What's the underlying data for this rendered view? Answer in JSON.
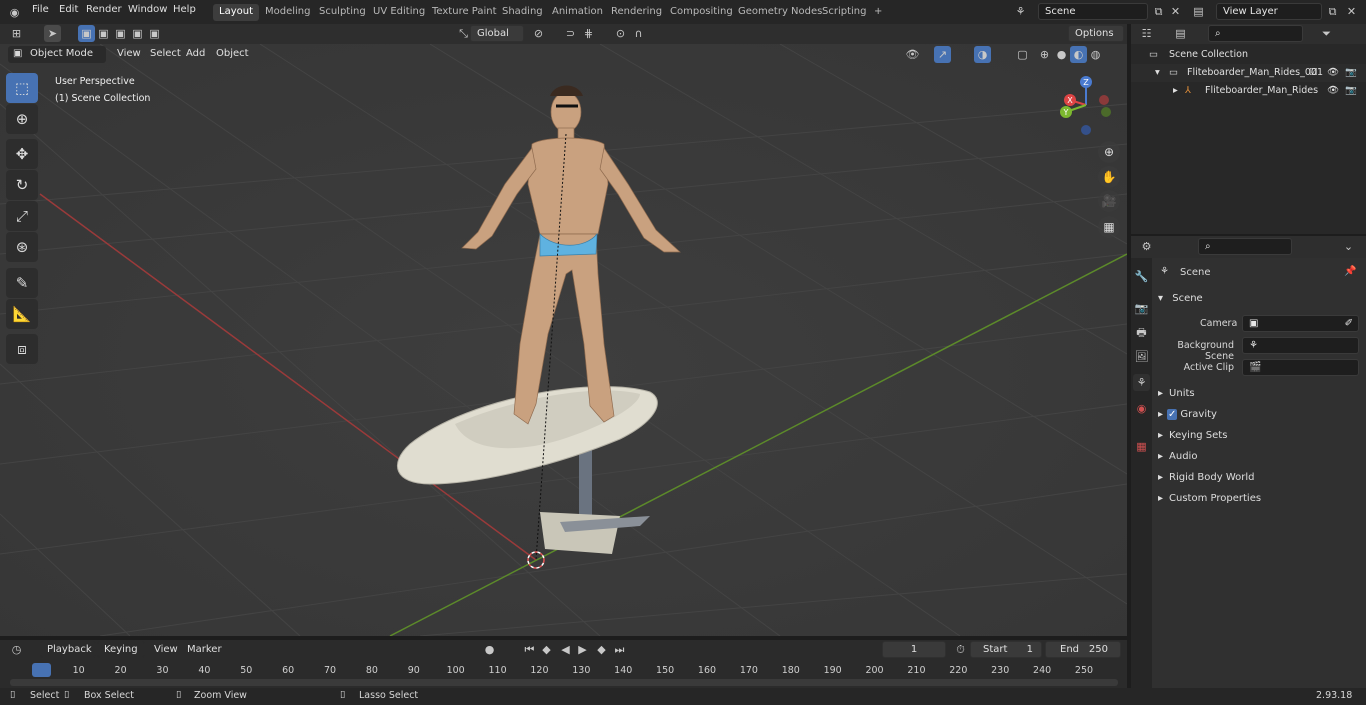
{
  "menus": [
    "File",
    "Edit",
    "Render",
    "Window",
    "Help"
  ],
  "workspaces": [
    "Layout",
    "Modeling",
    "Sculpting",
    "UV Editing",
    "Texture Paint",
    "Shading",
    "Animation",
    "Rendering",
    "Compositing",
    "Geometry Nodes",
    "Scripting"
  ],
  "add_workspace": "+",
  "scene_name": "Scene",
  "view_layer": "View Layer",
  "header": {
    "transform_orientation": "Global",
    "options": "Options"
  },
  "viewport": {
    "mode": "Object Mode",
    "menus": [
      "View",
      "Select",
      "Add",
      "Object"
    ],
    "perspective_label": "User Perspective",
    "collection_label": "(1) Scene Collection",
    "gizmo": {
      "x": "X",
      "y": "Y",
      "z": "Z"
    }
  },
  "outliner": {
    "items": [
      {
        "label": "Scene Collection",
        "level": 0
      },
      {
        "label": "Fliteboarder_Man_Rides_001",
        "level": 1
      },
      {
        "label": "Fliteboarder_Man_Rides",
        "level": 2
      }
    ]
  },
  "properties": {
    "context": "Scene",
    "section": "Scene",
    "fields": [
      {
        "label": "Camera",
        "value": ""
      },
      {
        "label": "Background Scene",
        "value": ""
      },
      {
        "label": "Active Clip",
        "value": ""
      }
    ],
    "panels": [
      "Units",
      "Gravity",
      "Keying Sets",
      "Audio",
      "Rigid Body World",
      "Custom Properties"
    ]
  },
  "timeline": {
    "menus": [
      "Playback",
      "Keying",
      "View",
      "Marker"
    ],
    "current_frame": "1",
    "start_label": "Start",
    "start_value": "1",
    "end_label": "End",
    "end_value": "250",
    "ticks": [
      "1",
      "10",
      "20",
      "30",
      "40",
      "50",
      "60",
      "70",
      "80",
      "90",
      "100",
      "110",
      "120",
      "130",
      "140",
      "150",
      "160",
      "170",
      "180",
      "190",
      "200",
      "210",
      "220",
      "230",
      "240",
      "250"
    ]
  },
  "statusbar": {
    "select": "Select",
    "box_select": "Box Select",
    "zoom_view": "Zoom View",
    "lasso_select": "Lasso Select",
    "version": "2.93.18"
  }
}
